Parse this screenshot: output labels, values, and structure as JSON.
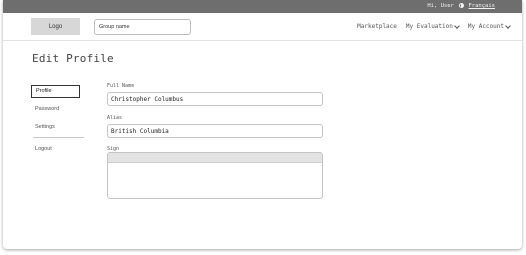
{
  "topbar": {
    "greeting": "Hi, User",
    "language_label": "Français",
    "language_icon": "globe-icon"
  },
  "header": {
    "logo_label": "Logo",
    "group_search": {
      "placeholder": "Group name",
      "value": ""
    },
    "nav": {
      "marketplace_label": "Marketplace",
      "evaluation_label": "My Evaluation",
      "account_label": "My Account",
      "dropdown_icon": "chevron-down-icon"
    }
  },
  "page": {
    "title": "Edit Profile"
  },
  "sidebar": {
    "items": [
      {
        "label": "Profile",
        "active": true
      },
      {
        "label": "Password",
        "active": false
      },
      {
        "label": "Settings",
        "active": false
      },
      {
        "label": "Logout",
        "active": false
      }
    ]
  },
  "form": {
    "full_name": {
      "label": "Full Name",
      "value": "Christopher Columbus"
    },
    "alias": {
      "label": "Alias",
      "value": "British Columbia"
    },
    "sign": {
      "label": "Sign",
      "value": ""
    }
  }
}
